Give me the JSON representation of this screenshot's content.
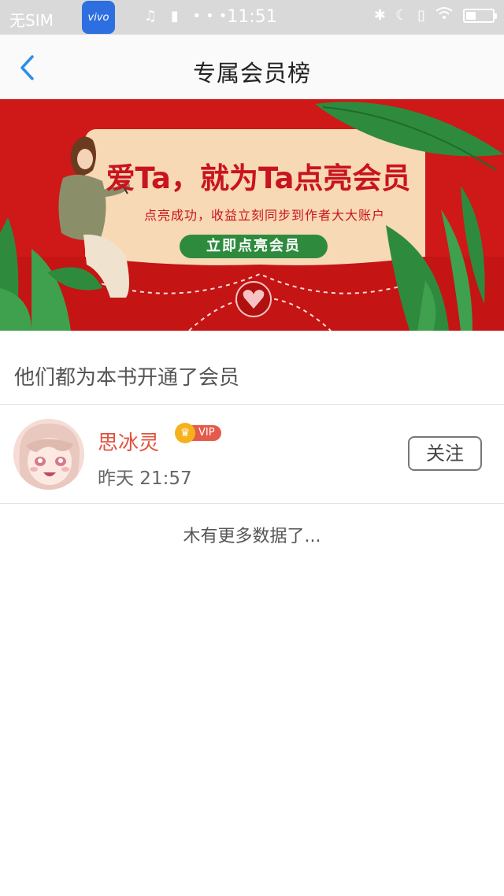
{
  "status_bar": {
    "carrier": "无SIM",
    "app_badge": "vivo",
    "time": "11:51"
  },
  "nav": {
    "title": "专属会员榜",
    "back_icon": "chevron-left-icon"
  },
  "banner": {
    "headline": "爱Ta，就为Ta点亮会员",
    "subtitle": "点亮成功，收益立刻同步到作者大大账户",
    "button_label": "立即点亮会员",
    "colors": {
      "background": "#cf1818",
      "card": "#f7d9b5",
      "button": "#2e8b3e",
      "leaf": "#2e8b3e"
    }
  },
  "section": {
    "title": "他们都为本书开通了会员"
  },
  "members": [
    {
      "name": "思冰灵",
      "badge": "VIP",
      "time": "昨天 21:57",
      "follow_label": "关注"
    }
  ],
  "footer": {
    "no_more": "木有更多数据了..."
  },
  "colors": {
    "accent_blue": "#2f8ee8",
    "name_red": "#e0533f",
    "vip_gold": "#f5b21b"
  }
}
